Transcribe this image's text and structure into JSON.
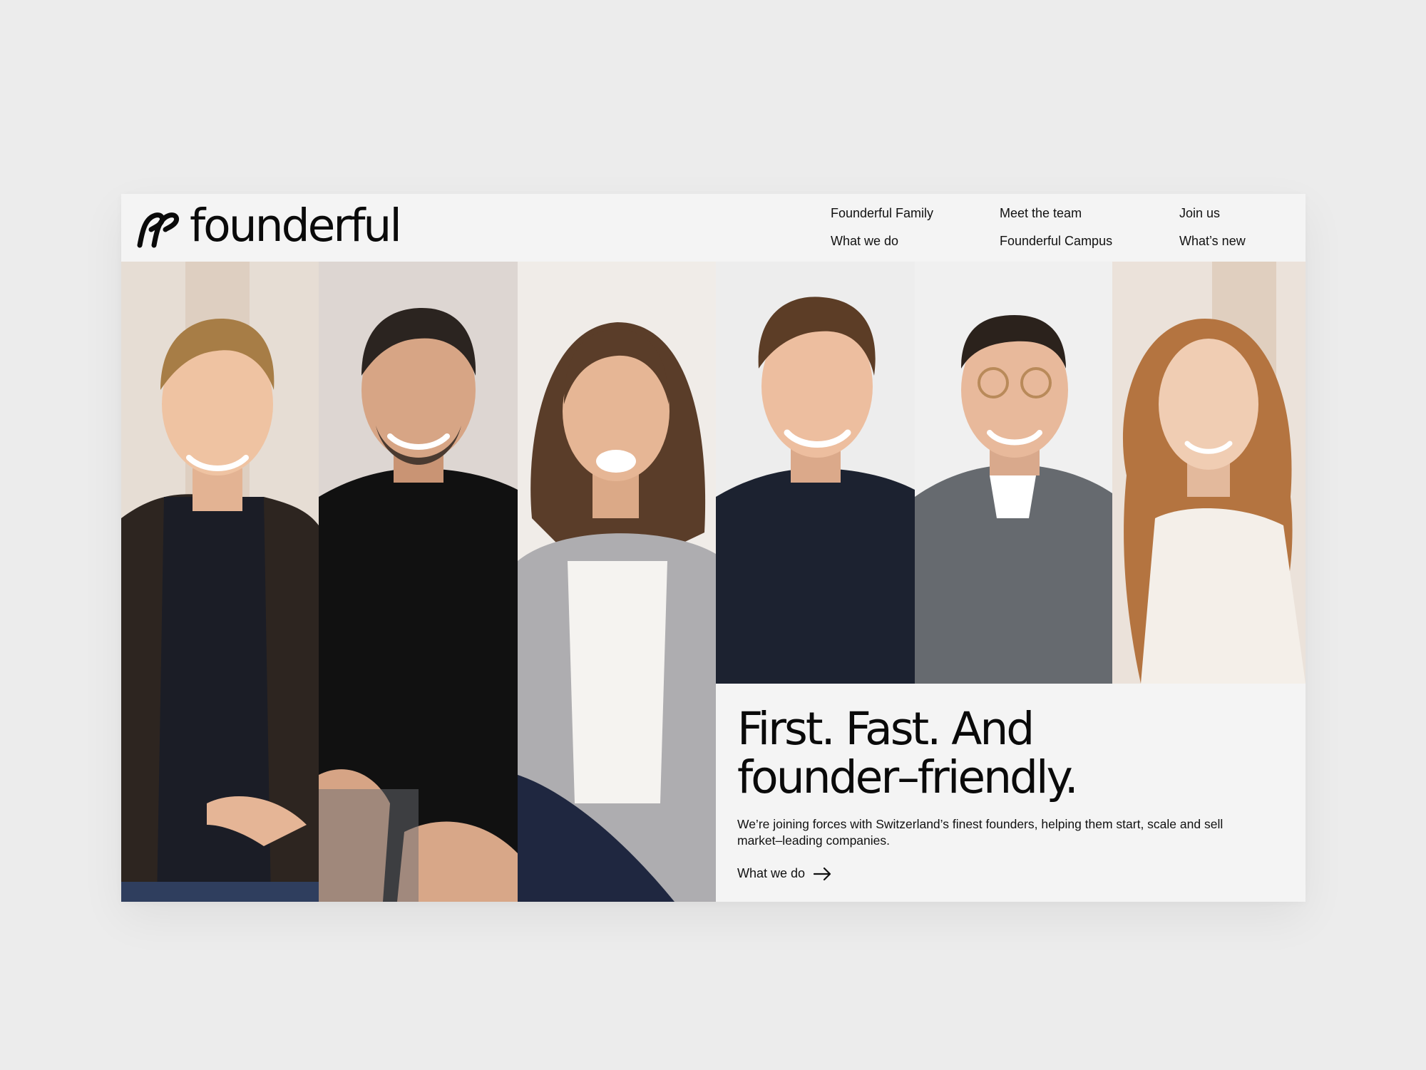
{
  "brand": {
    "name": "founderful"
  },
  "nav": {
    "items": [
      {
        "label": "Founderful Family"
      },
      {
        "label": "What we do"
      },
      {
        "label": "Meet the team"
      },
      {
        "label": "Founderful Campus"
      },
      {
        "label": "Join us"
      },
      {
        "label": "What’s new"
      }
    ]
  },
  "hero": {
    "title_line1": "First. Fast. And",
    "title_line2": "founder–friendly.",
    "body": "We’re joining forces with Switzerland’s finest founders, helping them start, scale and sell market–leading companies.",
    "cta_label": "What we do",
    "cta_icon": "arrow-right-icon"
  },
  "team_photos": [
    {
      "name": "team-photo-1",
      "background": "#e6ddd4",
      "hair": "#a77d46",
      "skin": "#efc3a2",
      "top": "#1b1d26",
      "jacket": "#2d2520"
    },
    {
      "name": "team-photo-2",
      "background": "#ddd6d2",
      "hair": "#2b2420",
      "skin": "#d7a585",
      "top": "#111111",
      "jacket": ""
    },
    {
      "name": "team-photo-3",
      "background": "#f0ece8",
      "hair": "#5a3d29",
      "skin": "#e6b695",
      "top": "#f5f3f0",
      "jacket": "#aeadb0"
    },
    {
      "name": "team-photo-4",
      "background": "#ededed",
      "hair": "#5c3d26",
      "skin": "#edbe9f",
      "top": "#1c2230",
      "jacket": ""
    },
    {
      "name": "team-photo-5",
      "background": "#f0f0f0",
      "hair": "#2b221c",
      "skin": "#e8b99b",
      "top": "#666a6f",
      "jacket": ""
    },
    {
      "name": "team-photo-6",
      "background": "#ebe2da",
      "hair": "#b47440",
      "skin": "#f0cdb3",
      "top": "#f4efe9",
      "jacket": ""
    }
  ],
  "colors": {
    "page_background": "#ececec",
    "card_background": "#f4f4f4",
    "text": "#0a0a0a"
  }
}
